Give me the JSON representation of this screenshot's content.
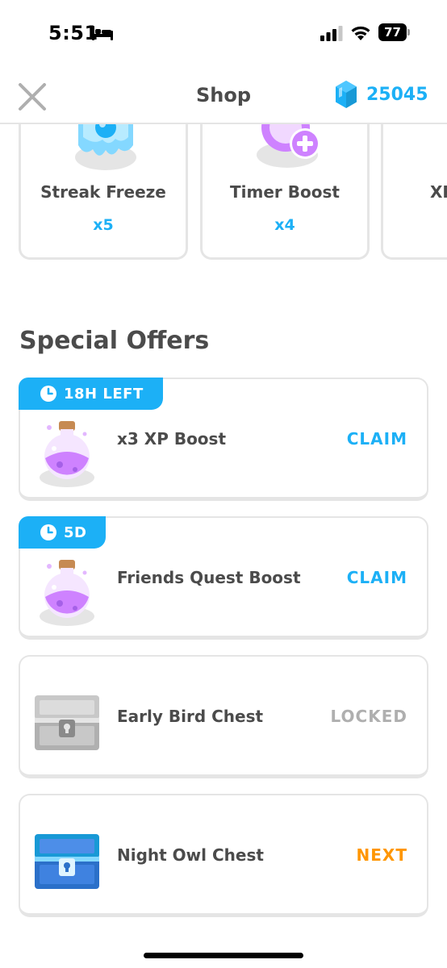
{
  "status_bar": {
    "time": "5:51",
    "battery": "77"
  },
  "header": {
    "title": "Shop",
    "gems": "25045"
  },
  "powerups": [
    {
      "name": "Streak Freeze",
      "qty": "x5",
      "icon": "ice-cube-icon"
    },
    {
      "name": "Timer Boost",
      "qty": "x4",
      "icon": "clock-plus-icon"
    },
    {
      "name": "XP",
      "qty": "",
      "icon": "xp-icon"
    }
  ],
  "special_offers": {
    "title": "Special Offers",
    "items": [
      {
        "tag": "18H LEFT",
        "name": "x3 XP Boost",
        "action": "CLAIM",
        "icon": "potion-icon"
      },
      {
        "tag": "5D",
        "name": "Friends Quest Boost",
        "action": "CLAIM",
        "icon": "potion-icon"
      },
      {
        "tag": "",
        "name": "Early Bird Chest",
        "action": "LOCKED",
        "icon": "gray-chest-icon"
      },
      {
        "tag": "",
        "name": "Night Owl Chest",
        "action": "NEXT",
        "icon": "blue-chest-icon"
      }
    ]
  },
  "colors": {
    "accent": "#1cb0f6",
    "locked": "#afafaf",
    "next": "#ff9600",
    "text": "#4b4b4b",
    "border": "#e5e5e5"
  }
}
